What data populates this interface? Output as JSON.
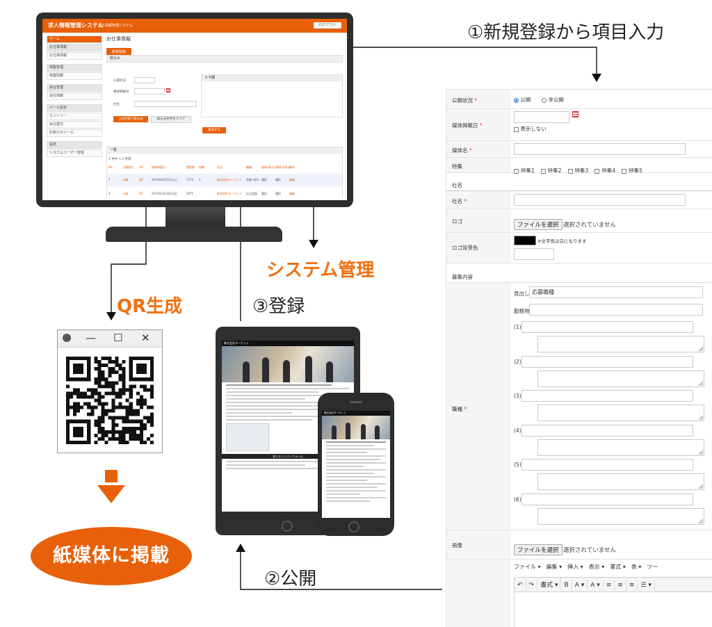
{
  "labels": {
    "step1": "①新規登録から項目入力",
    "step2": "②公開",
    "step3": "③登録",
    "system": "システム管理",
    "qr": "QR生成",
    "print": "紙媒体に掲載"
  },
  "colors": {
    "accent": "#e8600a",
    "label_orange": "#f07010"
  },
  "admin": {
    "app_title": "求人情報管理システム",
    "app_subtitle": "求人情報管理システム",
    "logout": "ログアウト",
    "sidebar": [
      {
        "label": "ホーム",
        "type": "home"
      },
      {
        "label": "お仕事情報",
        "type": "head"
      },
      {
        "label": "お仕事情報",
        "type": "item"
      },
      {
        "label": "特集管理",
        "type": "head"
      },
      {
        "label": "特集情報",
        "type": "item"
      },
      {
        "label": "会社管理",
        "type": "head"
      },
      {
        "label": "会社情報",
        "type": "item"
      },
      {
        "label": "メール設定",
        "type": "head"
      },
      {
        "label": "エントリー",
        "type": "item"
      },
      {
        "label": "会社案内",
        "type": "item"
      },
      {
        "label": "お知らせメール",
        "type": "item"
      },
      {
        "label": "設定",
        "type": "head"
      },
      {
        "label": "システムユーザー管理",
        "type": "item"
      }
    ],
    "page_title": "お仕事情報",
    "new_button": "新規登録",
    "filter_title": "絞込み",
    "filter_status": "公開状況",
    "filter_date": "媒体掲載日",
    "filter_company": "社名",
    "memo_title": "メモ欄",
    "search_button": "上記内容で絞込み",
    "clear_button": "絞込み条件をクリア",
    "save_button": "更新する",
    "list_title": "一覧",
    "list_count": "2 件中 1-2 件目",
    "table_headers": [
      "No.",
      "公開状況",
      "QR",
      "媒体掲載日",
      "閲覧数",
      "特集",
      "社名",
      "職種",
      "媒体(表示)",
      "媒体(非表示)",
      "操作"
    ],
    "rows": [
      [
        "7",
        "公開",
        "QR",
        "2019年6月25日(火)",
        "1774",
        "1",
        "株式会社ターゲット",
        "営業 (他1)",
        "選択",
        "選択",
        "編集"
      ],
      [
        "6",
        "公開",
        "QR",
        "2019年3月18日(金)",
        "1871",
        "",
        "株式会社ターゲット",
        "広告営業",
        "選択",
        "選択",
        "編集"
      ]
    ]
  },
  "form": {
    "status_label": "公開状況",
    "status_public": "公開",
    "status_private": "非公開",
    "date_label": "媒体掲載日",
    "date_hide": "表示しない",
    "media_label": "媒体名",
    "feature_label": "特集",
    "features": [
      "特集1",
      "特集2",
      "特集3",
      "特集4",
      "特集5"
    ],
    "company_section": "社名",
    "company_label": "社名",
    "logo_label": "ロゴ",
    "file_button": "ファイルを選択",
    "file_none": "選択されていません",
    "logo_bg_label": "ロゴ背景色",
    "logo_bg_note": "※文字色は白になります",
    "recruit_section": "募集内容",
    "heading_label": "見出し",
    "heading_value": "応募職種",
    "location_label": "勤務地",
    "job_label": "職種",
    "job_items": [
      "(1)",
      "(2)",
      "(3)",
      "(4)",
      "(5)",
      "(6)"
    ],
    "image_label": "画像",
    "editor_menu": [
      "ファイル ▾",
      "編集 ▾",
      "挿入 ▾",
      "表示 ▾",
      "書式 ▾",
      "表 ▾",
      "ツー"
    ],
    "editor_tools": [
      "↶",
      "↷",
      "書式 ▾",
      "B",
      "A ▾",
      "A ▾",
      "≡",
      "≡",
      "≡",
      "☰ ▾"
    ]
  },
  "site": {
    "header": "株式会社ターゲット",
    "form_title": "求人エントリーフォーム"
  },
  "qr_window": {
    "minimize": "—",
    "maximize": "☐",
    "close": "✕"
  }
}
